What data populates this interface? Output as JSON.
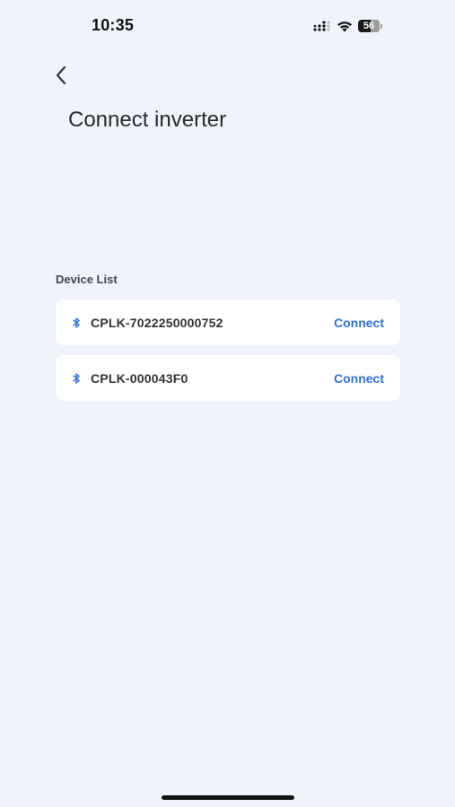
{
  "status_bar": {
    "time": "10:35",
    "battery": "56"
  },
  "header": {
    "title": "Connect inverter"
  },
  "device_list": {
    "label": "Device List",
    "devices": [
      {
        "name": "CPLK-7022250000752",
        "action": "Connect"
      },
      {
        "name": "CPLK-000043F0",
        "action": "Connect"
      }
    ]
  },
  "colors": {
    "background": "#eef3fc",
    "accent": "#2f6fe0",
    "card": "#ffffff"
  }
}
